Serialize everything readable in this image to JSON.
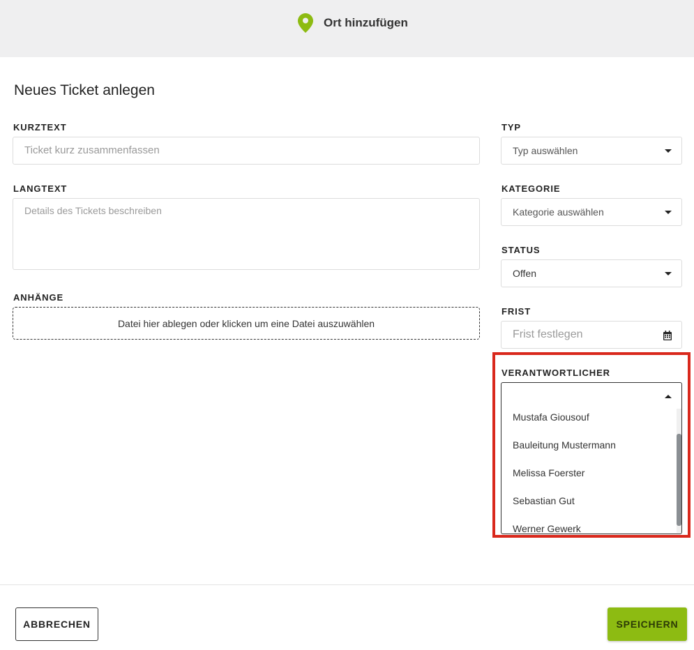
{
  "header": {
    "add_location_label": "Ort hinzufügen"
  },
  "page_title": "Neues Ticket anlegen",
  "form": {
    "kurztext": {
      "label": "KURZTEXT",
      "placeholder": "Ticket kurz zusammenfassen"
    },
    "langtext": {
      "label": "LANGTEXT",
      "placeholder": "Details des Tickets beschreiben"
    },
    "anhaenge": {
      "label": "ANHÄNGE",
      "dropzone_text": "Datei hier ablegen oder klicken um eine Datei auszuwählen"
    },
    "typ": {
      "label": "TYP",
      "placeholder": "Typ auswählen"
    },
    "kategorie": {
      "label": "KATEGORIE",
      "placeholder": "Kategorie auswählen"
    },
    "status": {
      "label": "STATUS",
      "value": "Offen"
    },
    "frist": {
      "label": "FRIST",
      "placeholder": "Frist festlegen"
    },
    "verantwortlicher": {
      "label": "VERANTWORTLICHER",
      "value": "",
      "options": [
        "Mustafa Giousouf",
        "Bauleitung Mustermann",
        "Melissa Foerster",
        "Sebastian Gut",
        "Werner Gewerk"
      ]
    }
  },
  "footer": {
    "cancel_label": "ABBRECHEN",
    "save_label": "SPEICHERN"
  },
  "colors": {
    "accent": "#8dbb12",
    "highlight": "#d9281c"
  },
  "icons": [
    "map-pin-icon",
    "chevron-down-icon",
    "calendar-icon",
    "chevron-up-icon"
  ]
}
